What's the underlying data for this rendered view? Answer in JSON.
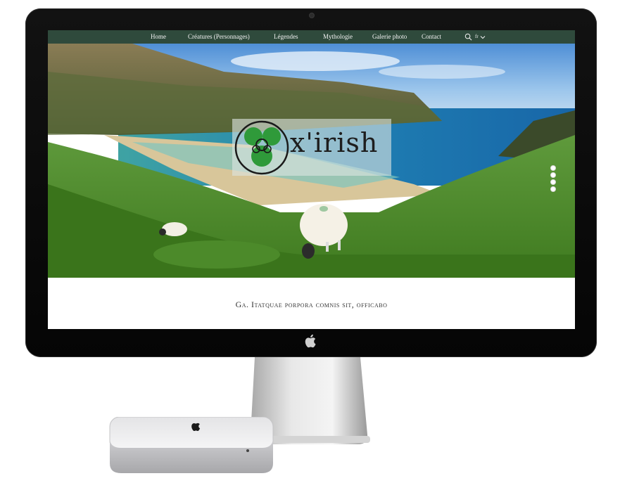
{
  "nav": {
    "items": [
      {
        "label": "Home"
      },
      {
        "label": "Créatures (Personnages)"
      },
      {
        "label": "Légendes"
      },
      {
        "label": "Mythologie"
      },
      {
        "label": "Galerie photo"
      },
      {
        "label": "Contact"
      }
    ],
    "language": "fr",
    "search_icon": "search-icon",
    "chevron_icon": "chevron-down-icon"
  },
  "logo": {
    "text": "x'irish",
    "emblem_icon": "shamrock-triskele-icon"
  },
  "hero": {
    "slides_total": 4
  },
  "tagline": "Ga. Itatquae porpora comnis sit, officabo",
  "colors": {
    "nav_bg": "#2f4a3c",
    "shamrock_green": "#2f9a3a",
    "bezel": "#0b0b0b"
  }
}
